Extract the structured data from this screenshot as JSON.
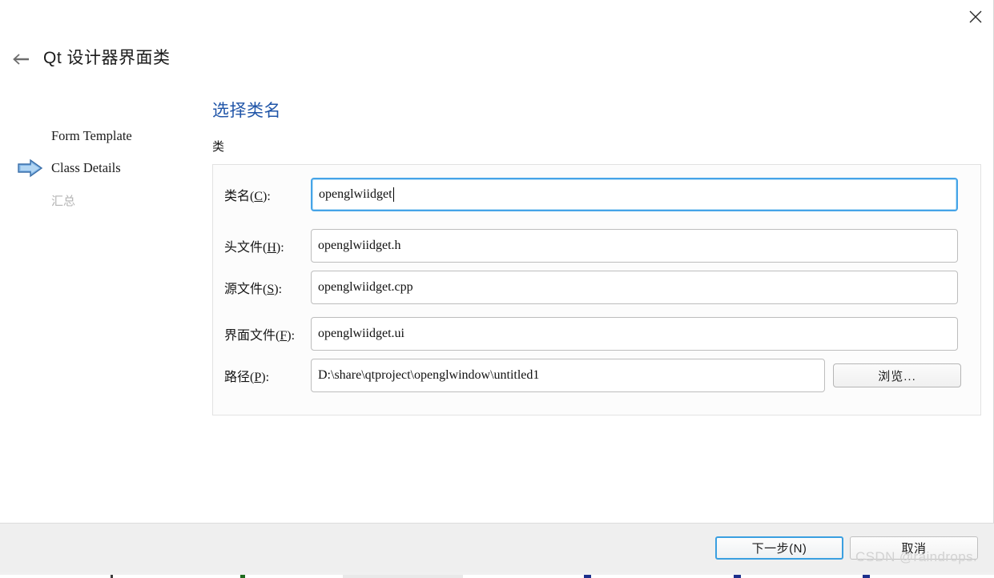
{
  "window": {
    "title": "Qt 设计器界面类",
    "close_icon": "close-icon",
    "back_icon": "back-arrow-icon"
  },
  "sidebar": {
    "items": [
      {
        "label": "Form Template",
        "active": false,
        "dimmed": false
      },
      {
        "label": "Class Details",
        "active": true,
        "dimmed": false
      },
      {
        "label": "汇总",
        "active": false,
        "dimmed": true
      }
    ],
    "marker_icon": "blue-arrow-icon"
  },
  "main": {
    "heading": "选择类名",
    "heading_color": "#2055a8",
    "group_label": "类",
    "fields": [
      {
        "label_prefix": "类名(",
        "accel": "C",
        "label_suffix": "):",
        "value": "openglwiidget",
        "focused": true
      },
      {
        "label_prefix": "头文件(",
        "accel": "H",
        "label_suffix": "):",
        "value": "openglwiidget.h",
        "focused": false
      },
      {
        "label_prefix": "源文件(",
        "accel": "S",
        "label_suffix": "):",
        "value": "openglwiidget.cpp",
        "focused": false
      },
      {
        "label_prefix": "界面文件(",
        "accel": "F",
        "label_suffix": "):",
        "value": "openglwiidget.ui",
        "focused": false
      },
      {
        "label_prefix": "路径(",
        "accel": "P",
        "label_suffix": "):",
        "value": "D:\\share\\qtproject\\openglwindow\\untitled1",
        "focused": false
      }
    ],
    "browse_label": "浏览..."
  },
  "footer": {
    "next_label": "下一步(N)",
    "next_accel": "N",
    "cancel_label": "取消",
    "accent_color": "#3a9fe0"
  },
  "watermark": {
    "text": "CSDN @raindrops."
  }
}
